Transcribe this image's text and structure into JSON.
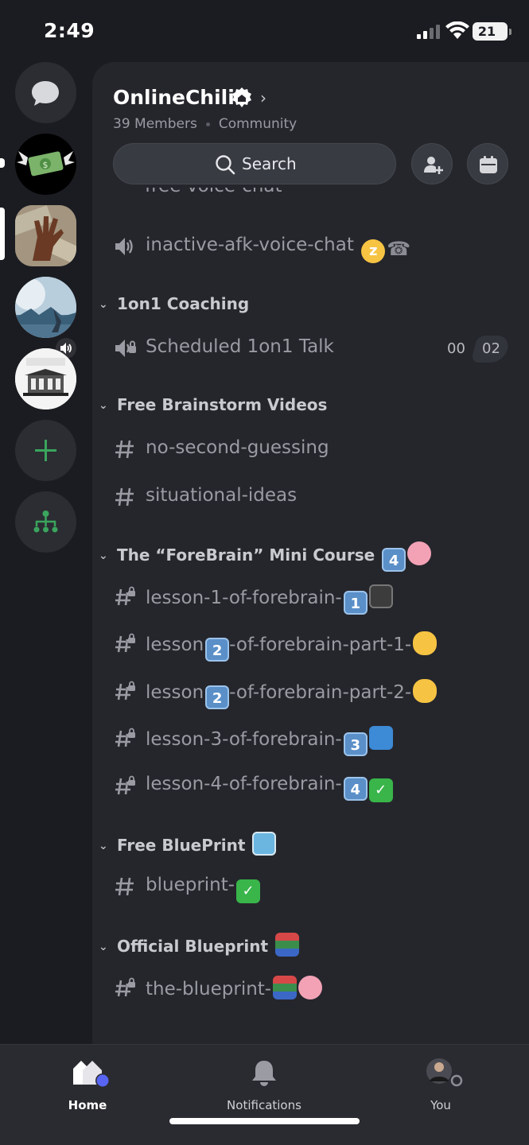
{
  "status_bar": {
    "time": "2:49",
    "battery": "21"
  },
  "server": {
    "name": "OnlineChili",
    "members": "39 Members",
    "type": "Community"
  },
  "search": {
    "label": "Search"
  },
  "partial_channel": "free-voice-chat",
  "voice_channels": [
    {
      "name": "inactive-afk-voice-chat"
    }
  ],
  "categories": [
    {
      "label": "1on1 Coaching"
    },
    {
      "label": "Free Brainstorm Videos"
    },
    {
      "label": "The “ForeBrain” Mini Course"
    },
    {
      "label": "Free BluePrint"
    },
    {
      "label": "Official Blueprint"
    }
  ],
  "stage_channel": {
    "name": "Scheduled 1on1 Talk",
    "count_a": "00",
    "count_b": "02"
  },
  "channels": {
    "no_second_guessing": "no-second-guessing",
    "situational_ideas": "situational-ideas",
    "lesson1": "lesson-1-of-forebrain-",
    "lesson2a_pre": "lesson",
    "lesson2a_post": "-of-forebrain-part-1-",
    "lesson2b_pre": "lesson",
    "lesson2b_post": "-of-forebrain-part-2-",
    "lesson3": "lesson-3-of-forebrain-",
    "lesson4": "lesson-4-of-forebrain-",
    "blueprint": "blueprint-",
    "the_blueprint": "the-blueprint-"
  },
  "keycaps": {
    "one": "1",
    "two": "2",
    "three": "3",
    "four": "4"
  },
  "tabs": {
    "home": "Home",
    "notifications": "Notifications",
    "you": "You"
  },
  "colors": {
    "accent_green": "#3ba55d",
    "home_dot": "#5865f2",
    "background": "#1b1c21",
    "panel": "#25262c"
  }
}
